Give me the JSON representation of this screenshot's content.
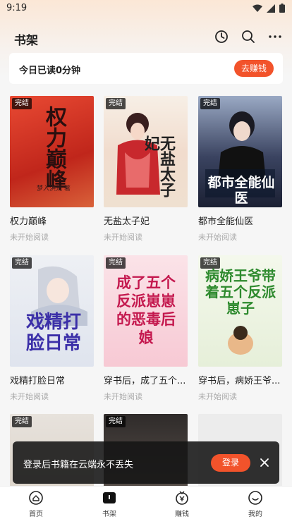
{
  "status": {
    "time": "9:19"
  },
  "header": {
    "title": "书架"
  },
  "reading": {
    "text": "今日已读0分钟",
    "button": "去赚钱"
  },
  "books": [
    {
      "title": "权力巅峰",
      "status": "未开始阅读",
      "badge": "完结",
      "cover_text": "权力巅峰",
      "cover_author": "梦入洪荒 著"
    },
    {
      "title": "无盐太子妃",
      "status": "未开始阅读",
      "badge": "完结",
      "cover_text": "无盐太子妃",
      "cover_author": ""
    },
    {
      "title": "都市全能仙医",
      "status": "未开始阅读",
      "badge": "完结",
      "cover_text": "都市全能仙医",
      "cover_author": ""
    },
    {
      "title": "戏精打脸日常",
      "status": "未开始阅读",
      "badge": "完结",
      "cover_text": "戏精打脸日常",
      "cover_author": ""
    },
    {
      "title": "穿书后，成了五个...",
      "status": "未开始阅读",
      "badge": "完结",
      "cover_text": "成了五个反派崽崽的恶毒后娘",
      "cover_author": ""
    },
    {
      "title": "穿书后，病娇王爷...",
      "status": "未开始阅读",
      "badge": "完结",
      "cover_text": "病娇王爷带着五个反派崽子",
      "cover_author": ""
    },
    {
      "title": "",
      "status": "",
      "badge": "完结",
      "cover_text": "",
      "cover_author": ""
    },
    {
      "title": "",
      "status": "",
      "badge": "完结",
      "cover_text": "",
      "cover_author": ""
    }
  ],
  "login_banner": {
    "text": "登录后书籍在云端永不丢失",
    "button": "登录"
  },
  "nav": [
    {
      "label": "首页",
      "icon": "home-icon"
    },
    {
      "label": "书架",
      "icon": "bookshelf-icon"
    },
    {
      "label": "赚钱",
      "icon": "money-icon"
    },
    {
      "label": "我的",
      "icon": "profile-icon"
    }
  ],
  "colors": {
    "accent": "#f2532b"
  }
}
